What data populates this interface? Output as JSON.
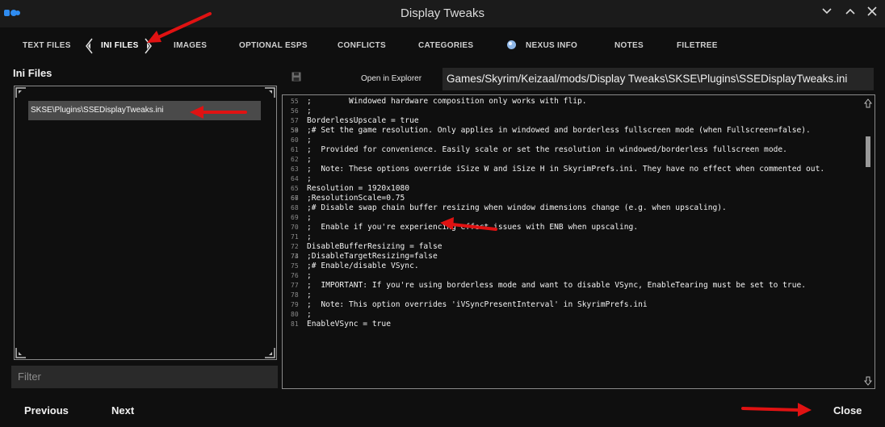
{
  "window": {
    "title": "Display Tweaks"
  },
  "tabs": [
    {
      "label": "TEXT FILES"
    },
    {
      "label": "INI FILES"
    },
    {
      "label": "IMAGES"
    },
    {
      "label": "OPTIONAL ESPS"
    },
    {
      "label": "CONFLICTS"
    },
    {
      "label": "CATEGORIES"
    },
    {
      "label": "NEXUS INFO"
    },
    {
      "label": "NOTES"
    },
    {
      "label": "FILETREE"
    }
  ],
  "left_panel": {
    "title": "Ini Files",
    "files": [
      "SKSE\\Plugins\\SSEDisplayTweaks.ini"
    ],
    "filter_placeholder": "Filter"
  },
  "editor": {
    "open_in_explorer": "Open in Explorer",
    "path": "Games/Skyrim/Keizaal/mods/Display Tweaks\\SKSE\\Plugins\\SSEDisplayTweaks.ini",
    "lines": [
      {
        "n": "55",
        "text": ";        Windowed hardware composition only works with flip."
      },
      {
        "n": "56",
        "text": ";"
      },
      {
        "n": "57",
        "text": "BorderlessUpscale = true"
      },
      {
        "n": "58",
        "text": ""
      },
      {
        "n": "59",
        "text": ";# Set the game resolution. Only applies in windowed and borderless fullscreen mode (when Fullscreen=false)."
      },
      {
        "n": "60",
        "text": ";"
      },
      {
        "n": "61",
        "text": ";  Provided for convenience. Easily scale or set the resolution in windowed/borderless fullscreen mode."
      },
      {
        "n": "62",
        "text": ";"
      },
      {
        "n": "63",
        "text": ";  Note: These options override iSize W and iSize H in SkyrimPrefs.ini. They have no effect when commented out."
      },
      {
        "n": "64",
        "text": ";"
      },
      {
        "n": "65",
        "text": "Resolution = 1920x1080"
      },
      {
        "n": "66",
        "text": ""
      },
      {
        "n": "67",
        "text": ";ResolutionScale=0.75"
      },
      {
        "n": "68",
        "text": ";# Disable swap chain buffer resizing when window dimensions change (e.g. when upscaling)."
      },
      {
        "n": "69",
        "text": ";"
      },
      {
        "n": "70",
        "text": ";  Enable if you're experiencing effect issues with ENB when upscaling."
      },
      {
        "n": "71",
        "text": ";"
      },
      {
        "n": "72",
        "text": "DisableBufferResizing = false"
      },
      {
        "n": "73",
        "text": ""
      },
      {
        "n": "74",
        "text": ";DisableTargetResizing=false"
      },
      {
        "n": "75",
        "text": ";# Enable/disable VSync."
      },
      {
        "n": "76",
        "text": ";"
      },
      {
        "n": "77",
        "text": ";  IMPORTANT: If you're using borderless mode and want to disable VSync, EnableTearing must be set to true."
      },
      {
        "n": "78",
        "text": ";"
      },
      {
        "n": "79",
        "text": ";  Note: This option overrides 'iVSyncPresentInterval' in SkyrimPrefs.ini"
      },
      {
        "n": "80",
        "text": ";"
      },
      {
        "n": "81",
        "text": "EnableVSync = true"
      }
    ],
    "scroll_position": 0.12
  },
  "footer": {
    "previous_label": "Previous",
    "next_label": "Next",
    "close_label": "Close"
  },
  "colors": {
    "background": "#0f0f0f",
    "titlebar": "#1b1b1b",
    "selection": "#4a4a4a",
    "annotation_arrow": "#e01212"
  }
}
